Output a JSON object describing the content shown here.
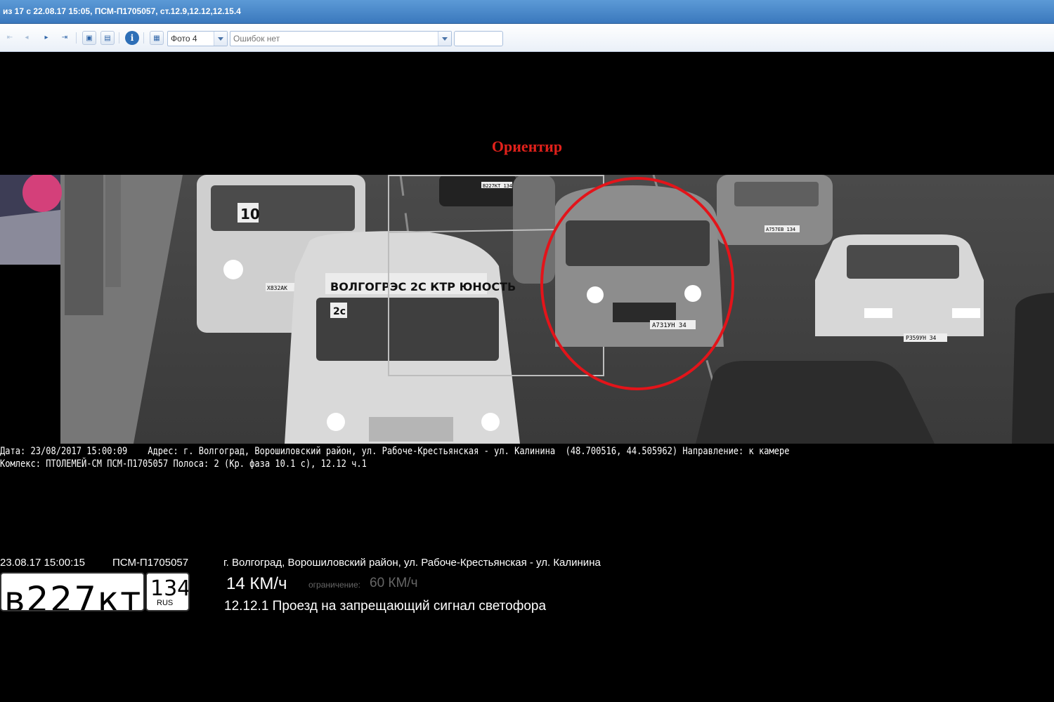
{
  "window": {
    "title": "из 17 с 22.08.17 15:05, ПСМ-П1705057, ст.12.9,12.12,12.15.4"
  },
  "toolbar": {
    "buttons": [
      "first-page",
      "prev-page",
      "next-page",
      "last-page",
      "image-view",
      "print",
      "info",
      "grid-view"
    ],
    "photo_select": "Фото 4",
    "errors_select": "Ошибок нет",
    "blank_field": ""
  },
  "photo": {
    "label": "Ориентир",
    "label_color": "#e1211b",
    "marker_color": "#e3141a",
    "plates": {
      "van": "А731УН 34",
      "car_left": "Х832АК",
      "car_right": "Р359УН 34",
      "car_back": "А757ЕВ 134",
      "car_top": "В227КТ 134"
    },
    "bus_signs": {
      "route_left": "10",
      "sign_main": "ВОЛГОГРЭС 2С КТР ЮНОСТЬ",
      "route_main": "2с"
    }
  },
  "overlay": {
    "line1": "Дата: 23/08/2017 15:00:09    Адрес: г. Волгоград, Ворошиловский район, ул. Рабоче-Крестьянская - ул. Калинина  (48.700516, 44.505962) Направление: к камере",
    "line2": "Комлекс: ПТОЛЕМЕЙ-СМ ПСМ-П1705057 Полоса: 2 (Кр. фаза 10.1 с), 12.12 ч.1"
  },
  "record": {
    "datetime": "23.08.17 15:00:15",
    "device": "ПСМ-П1705057",
    "address": "г. Волгоград, Ворошиловский район, ул. Рабоче-Крестьянская - ул. Калинина",
    "plate_main": "в227кт",
    "plate_region": "134",
    "plate_country": "RUS",
    "speed": "14 КМ/ч",
    "limit_label": "ограничение:",
    "limit_value": "60 КМ/ч",
    "violation": "12.12.1 Проезд на запрещающий сигнал светофора"
  }
}
